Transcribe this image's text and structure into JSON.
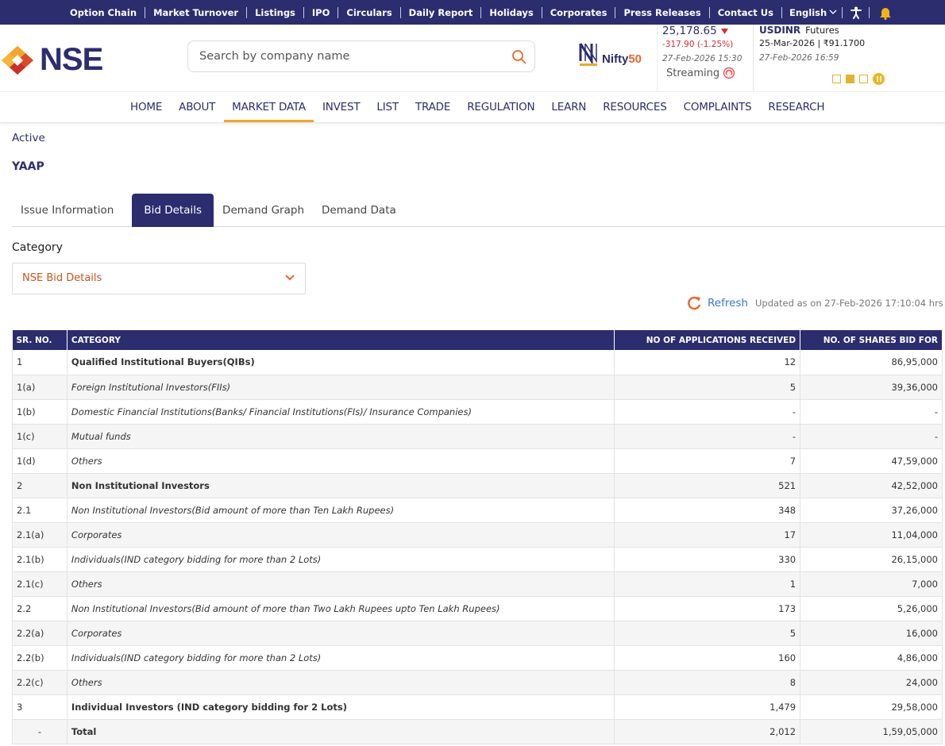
{
  "colors": {
    "primary": "#2b2d6f",
    "accent": "#e9a92c",
    "negative": "#d82b2b",
    "link": "#3a76c4",
    "select_text": "#c9541d"
  },
  "topbar": {
    "links": [
      "Option Chain",
      "Market Turnover",
      "Listings",
      "IPO",
      "Circulars",
      "Daily Report",
      "Holidays",
      "Corporates",
      "Press Releases",
      "Contact Us"
    ],
    "language": "English",
    "icons": [
      "accessibility-icon",
      "bell-icon"
    ]
  },
  "header": {
    "logo_text": "NSE",
    "search_placeholder": "Search by company name",
    "nifty": {
      "brand": "Nifty",
      "brand_num": "50"
    },
    "index": {
      "price": "25,178.65",
      "change": "-317.90 (-1.25%)",
      "timestamp": "27-Feb-2026 15:30",
      "stream_label": "Streaming"
    },
    "fx": {
      "symbol": "USDINR",
      "type": "Futures",
      "line": "25-Mar-2026 | ₹91.1700",
      "timestamp": "27-Feb-2026 16:59"
    }
  },
  "nav": {
    "items": [
      "HOME",
      "ABOUT",
      "MARKET DATA",
      "INVEST",
      "LIST",
      "TRADE",
      "REGULATION",
      "LEARN",
      "RESOURCES",
      "COMPLAINTS",
      "RESEARCH"
    ],
    "active": "MARKET DATA"
  },
  "page": {
    "status": "Active",
    "symbol": "YAAP",
    "tabs": [
      "Issue Information",
      "Bid Details",
      "Demand Graph",
      "Demand Data"
    ],
    "active_tab": "Bid Details",
    "category_label": "Category",
    "category_value": "NSE Bid Details",
    "refresh_label": "Refresh",
    "updated_text": "Updated as on 27-Feb-2026 17:10:04 hrs"
  },
  "table": {
    "headers": [
      "SR. NO.",
      "CATEGORY",
      "NO OF APPLICATIONS RECEIVED",
      "NO. OF SHARES BID FOR"
    ],
    "rows": [
      {
        "sr": "1",
        "category": "Qualified Institutional Buyers(QIBs)",
        "apps": "12",
        "shares": "86,95,000",
        "style": "main"
      },
      {
        "sr": "1(a)",
        "category": "Foreign Institutional Investors(FIIs)",
        "apps": "5",
        "shares": "39,36,000",
        "style": "sub"
      },
      {
        "sr": "1(b)",
        "category": "Domestic Financial Institutions(Banks/ Financial Institutions(FIs)/ Insurance Companies)",
        "apps": "-",
        "shares": "-",
        "style": "sub"
      },
      {
        "sr": "1(c)",
        "category": "Mutual funds",
        "apps": "-",
        "shares": "-",
        "style": "sub"
      },
      {
        "sr": "1(d)",
        "category": "Others",
        "apps": "7",
        "shares": "47,59,000",
        "style": "sub"
      },
      {
        "sr": "2",
        "category": "Non Institutional Investors",
        "apps": "521",
        "shares": "42,52,000",
        "style": "main"
      },
      {
        "sr": "2.1",
        "category": "Non Institutional Investors(Bid amount of more than Ten Lakh Rupees)",
        "apps": "348",
        "shares": "37,26,000",
        "style": "sub"
      },
      {
        "sr": "2.1(a)",
        "category": "Corporates",
        "apps": "17",
        "shares": "11,04,000",
        "style": "sub"
      },
      {
        "sr": "2.1(b)",
        "category": "Individuals(IND category bidding for more than 2 Lots)",
        "apps": "330",
        "shares": "26,15,000",
        "style": "sub"
      },
      {
        "sr": "2.1(c)",
        "category": "Others",
        "apps": "1",
        "shares": "7,000",
        "style": "sub"
      },
      {
        "sr": "2.2",
        "category": "Non Institutional Investors(Bid amount of more than Two Lakh Rupees upto Ten Lakh Rupees)",
        "apps": "173",
        "shares": "5,26,000",
        "style": "sub"
      },
      {
        "sr": "2.2(a)",
        "category": "Corporates",
        "apps": "5",
        "shares": "16,000",
        "style": "sub"
      },
      {
        "sr": "2.2(b)",
        "category": "Individuals(IND category bidding for more than 2 Lots)",
        "apps": "160",
        "shares": "4,86,000",
        "style": "sub"
      },
      {
        "sr": "2.2(c)",
        "category": "Others",
        "apps": "8",
        "shares": "24,000",
        "style": "sub"
      },
      {
        "sr": "3",
        "category": "Individual Investors (IND category bidding for 2 Lots)",
        "apps": "1,479",
        "shares": "29,58,000",
        "style": "main"
      },
      {
        "sr": "-",
        "category": "Total",
        "apps": "2,012",
        "shares": "1,59,05,000",
        "style": "main"
      }
    ]
  }
}
